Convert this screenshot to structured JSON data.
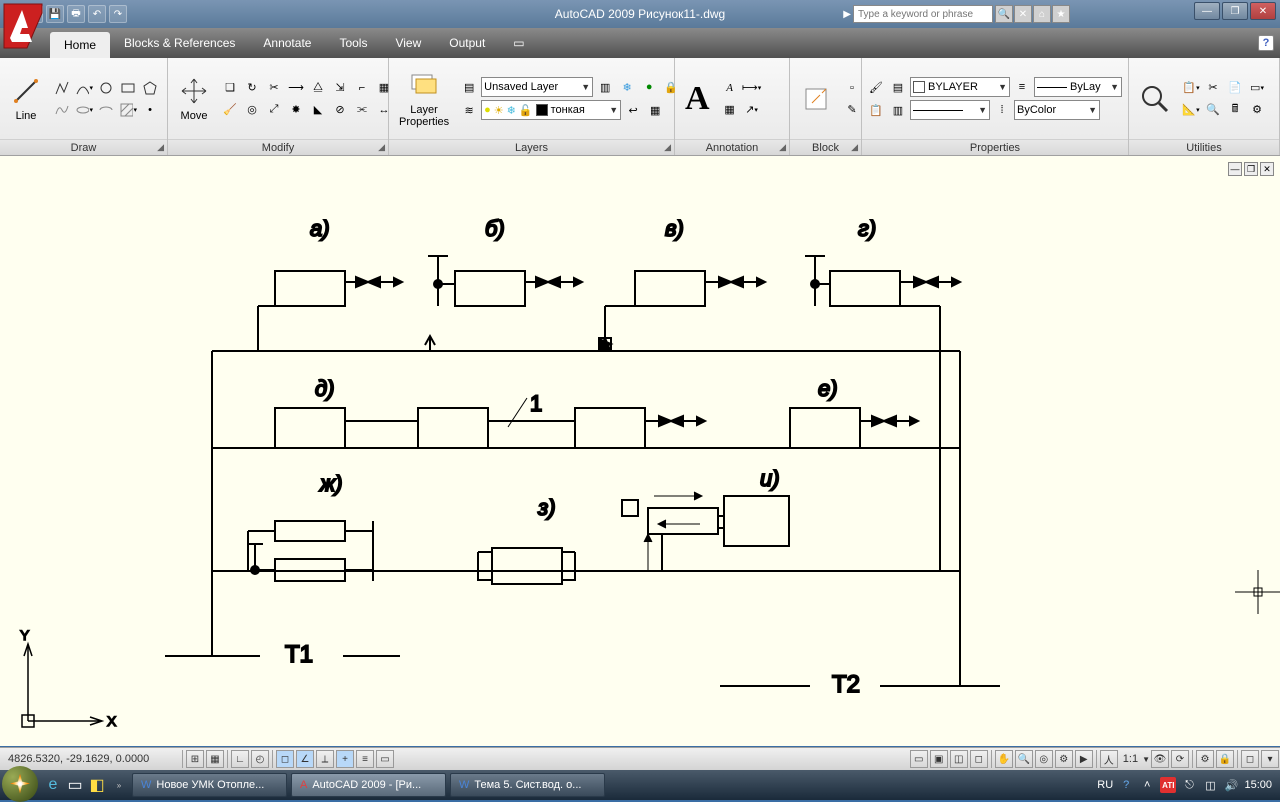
{
  "app": {
    "title": "AutoCAD 2009 Рисунок11-.dwg",
    "search_placeholder": "Type a keyword or phrase"
  },
  "tabs": [
    "Home",
    "Blocks & References",
    "Annotate",
    "Tools",
    "View",
    "Output"
  ],
  "panels": {
    "draw": {
      "title": "Draw",
      "line": "Line"
    },
    "modify": {
      "title": "Modify",
      "move": "Move"
    },
    "layers": {
      "title": "Layers",
      "lp": "Layer\nProperties",
      "layer1": "Unsaved Layer",
      "layer2": "тонкая"
    },
    "annotation": {
      "title": "Annotation"
    },
    "block": {
      "title": "Block"
    },
    "properties": {
      "title": "Properties",
      "color": "BYLAYER",
      "ltype": "ByLay",
      "pstyle": "ByColor"
    },
    "utilities": {
      "title": "Utilities"
    }
  },
  "diagram": {
    "labels": {
      "a": "а)",
      "b": "б)",
      "v": "в)",
      "g": "г)",
      "d": "д)",
      "e": "е)",
      "zh": "ж)",
      "z": "з)",
      "i": "и)",
      "num1": "1",
      "T1": "Т1",
      "T2": "Т2",
      "X": "X",
      "Y": "Y"
    }
  },
  "status": {
    "coords": "4826.5320, -29.1629, 0.0000",
    "scale": "1:1"
  },
  "taskbar": {
    "items": [
      "Новое УМК Отопле...",
      "AutoCAD 2009 - [Ри...",
      "Тема 5. Сист.вод. о..."
    ],
    "lang": "RU",
    "time": "15:00"
  }
}
